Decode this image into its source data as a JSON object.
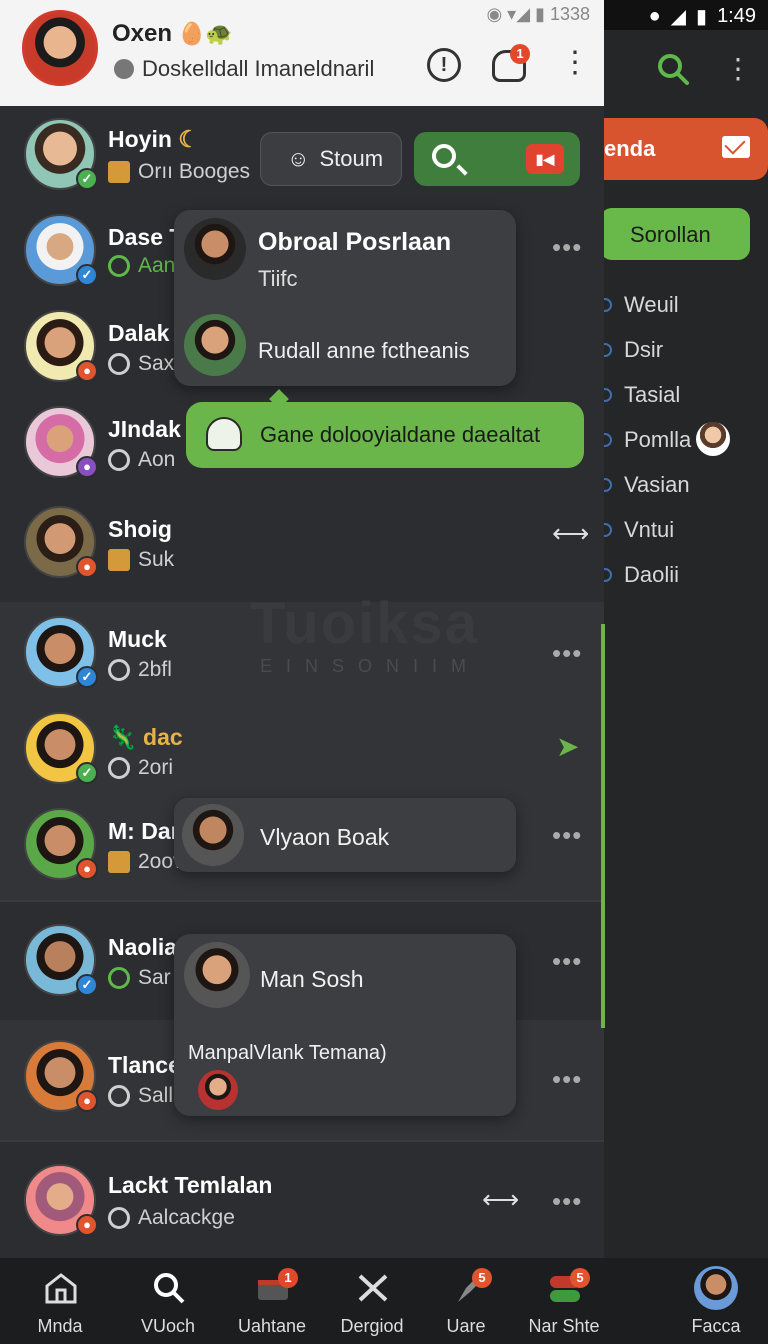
{
  "status_bar": {
    "left_status": "◉ ▾◢ ▮ 1338",
    "right_time": "1:49"
  },
  "header": {
    "title": "Oxen",
    "subtitle": "Doskelldall Imaneldnaril",
    "notification_count": "1"
  },
  "toolbar": {
    "stoum_label": "Stoum",
    "record_label": "▮◀"
  },
  "contacts": [
    {
      "name": "Hoyin",
      "sub": "Orıı Booges",
      "status_color": "#4caf50"
    },
    {
      "name": "Dase T",
      "sub": "Aan",
      "status_color": "#2f86d6"
    },
    {
      "name": "Dalak",
      "sub": "Sax",
      "status_color": "#e0542e"
    },
    {
      "name": "JIndak",
      "sub": "Aon",
      "status_color": "#8a4fbf"
    },
    {
      "name": "Shoig",
      "sub": "Suk",
      "status_color": "#e0542e"
    },
    {
      "name": "Muck",
      "sub": "2bfl",
      "status_color": "#2f86d6"
    },
    {
      "name": "dac",
      "sub": "2ori",
      "status_color": "#4caf50"
    },
    {
      "name": "M: Dar",
      "sub": "2oov",
      "status_color": "#e0542e"
    },
    {
      "name": "Naolia",
      "sub": "Sar",
      "status_color": "#2f86d6"
    },
    {
      "name": "Tlance",
      "sub": "Sall",
      "status_color": "#e0542e"
    },
    {
      "name": "Lackt Temlalan",
      "sub": "Aalcackge",
      "status_color": "#e0542e"
    }
  ],
  "popups": {
    "card1_title": "Obroal Posrlaan",
    "card1_sub": "Tiifc",
    "card1_line": "Rudall anne fctheanis",
    "green_message": "Gane dolooyialdane daealtat",
    "card2_name": "Vlyaon Boak",
    "card3_name": "Man Sosh",
    "card3_line": "ManpalVlank Temana)"
  },
  "watermark": {
    "title": "Tuoiksa",
    "subtitle": "EINSONIIM"
  },
  "right_panel": {
    "banner": "enda",
    "green_pill": "Sorollan",
    "items": [
      "Weuil",
      "Dsir",
      "Tasial",
      "Pomlla",
      "Vasian",
      "Vntui",
      "Daolii"
    ]
  },
  "bottom_nav": [
    {
      "label": "Mnda",
      "badge": ""
    },
    {
      "label": "VUoch",
      "badge": ""
    },
    {
      "label": "Uahtane",
      "badge": "1"
    },
    {
      "label": "Dergiod",
      "badge": ""
    },
    {
      "label": "Uare",
      "badge": "5"
    },
    {
      "label": "Nar Shte",
      "badge": "5"
    },
    {
      "label": "Facca",
      "badge": ""
    }
  ],
  "colors": {
    "accent_green": "#6ab64a",
    "accent_orange": "#d8542f",
    "badge_red": "#e04a2b"
  }
}
